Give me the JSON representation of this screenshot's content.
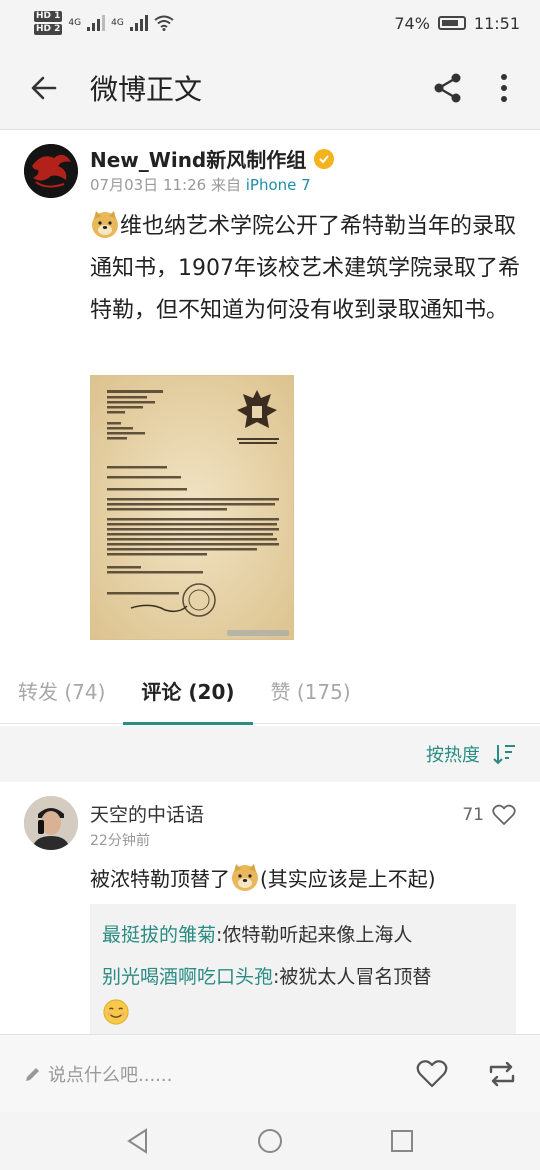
{
  "status_bar": {
    "hd1": "HD 1",
    "hd2": "HD 2",
    "signal_1": "4G",
    "signal_2": "4G",
    "battery_percent": "74%",
    "time": "11:51"
  },
  "header": {
    "title": "微博正文"
  },
  "post": {
    "author": "New_Wind新风制作组",
    "date": "07月03日 11:26",
    "source_label": "来自",
    "device": "iPhone 7",
    "text": "维也纳艺术学院公开了希特勒当年的录取通知书，1907年该校艺术建筑学院录取了希特勒，但不知道为何没有收到录取通知书。"
  },
  "tabs": [
    {
      "label": "转发 (74)"
    },
    {
      "label": "评论 (20)"
    },
    {
      "label": "赞 (175)"
    }
  ],
  "sort": {
    "label": "按热度"
  },
  "comment": {
    "name": "天空的中话语",
    "time": "22分钟前",
    "likes": "71",
    "text_before": "被浓特勒顶替了",
    "text_after": "(其实应该是上不起)",
    "replies": [
      {
        "name": "最挺拔的雏菊",
        "text": ":侬特勒听起来像上海人"
      },
      {
        "name": "别光喝酒啊吃口头孢",
        "text": ":被犹太人冒名顶替"
      }
    ]
  },
  "bottom_bar": {
    "placeholder": "说点什么吧......"
  }
}
